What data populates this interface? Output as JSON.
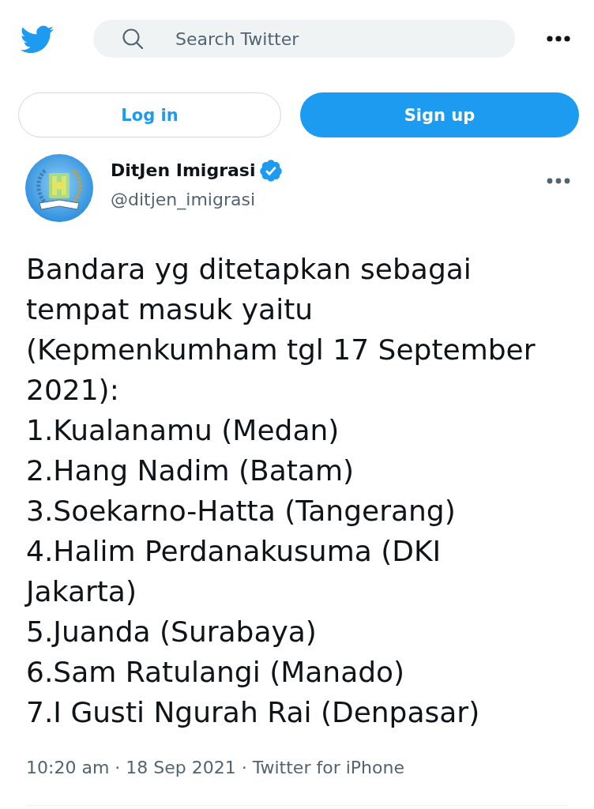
{
  "header": {
    "search": {
      "placeholder": "Search Twitter"
    }
  },
  "auth_buttons": [
    {
      "label": "Log in",
      "kind": "outline"
    },
    {
      "label": "Sign up",
      "kind": "filled"
    }
  ],
  "tweet": {
    "author": {
      "name": "DitJen Imigrasi",
      "verified": true,
      "handle": "@ditjen_imigrasi"
    },
    "text": "Bandara yg ditetapkan sebagai tempat masuk yaitu (Kepmenkumham tgl 17 September 2021):\n1.Kualanamu (Medan)\n2.Hang Nadim (Batam)\n3.Soekarno-Hatta (Tangerang)\n4.Halim Perdanakusuma (DKI Jakarta)\n5.Juanda (Surabaya)\n6.Sam Ratulangi (Manado)\n7.I Gusti Ngurah Rai (Denpasar)",
    "meta": "10:20 am · 18 Sep 2021 · Twitter for iPhone"
  }
}
